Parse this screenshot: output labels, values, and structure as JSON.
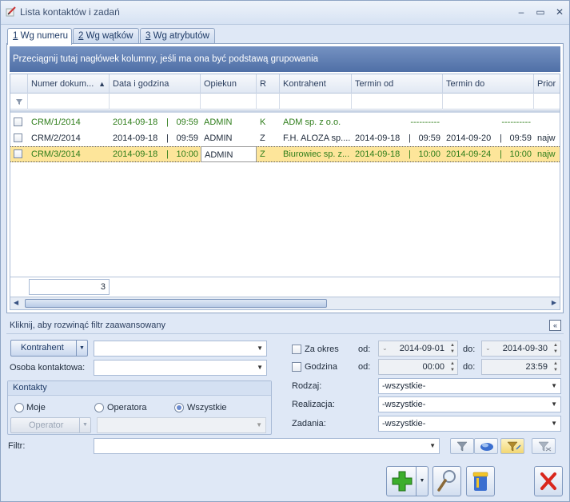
{
  "window": {
    "title": "Lista kontaktów i zadań",
    "minimize": "–",
    "maximize": "▭",
    "close": "✕"
  },
  "tabs": [
    {
      "key": "1",
      "label": " Wg numeru"
    },
    {
      "key": "2",
      "label": " Wg wątków"
    },
    {
      "key": "3",
      "label": " Wg atrybutów"
    }
  ],
  "grid": {
    "group_hint": "Przeciągnij tutaj nagłówek kolumny, jeśli ma ona być podstawą grupowania",
    "columns": [
      "Numer dokum...",
      "Data i godzina",
      "Opiekun",
      "R",
      "Kontrahent",
      "Termin od",
      "Termin do",
      "Prior"
    ],
    "sort_indicator": "▲",
    "rows": [
      {
        "numer": "CRM/1/2014",
        "data": "2014-09-18",
        "godz": "09:59",
        "opiekun": "ADMIN",
        "r": "K",
        "kontrahent": "ADM sp. z o.o.",
        "od_data": "----------",
        "od_godz": "",
        "do_data": "----------",
        "do_godz": "",
        "prior": ""
      },
      {
        "numer": "CRM/2/2014",
        "data": "2014-09-18",
        "godz": "09:59",
        "opiekun": "ADMIN",
        "r": "Z",
        "kontrahent": "F.H. ALOZA sp....",
        "od_data": "2014-09-18",
        "od_godz": "09:59",
        "do_data": "2014-09-20",
        "do_godz": "09:59",
        "prior": "najw"
      },
      {
        "numer": "CRM/3/2014",
        "data": "2014-09-18",
        "godz": "10:00",
        "opiekun": "ADMIN",
        "r": "Z",
        "kontrahent": "Biurowiec sp. z...",
        "od_data": "2014-09-18",
        "od_godz": "10:00",
        "do_data": "2014-09-24",
        "do_godz": "10:00",
        "prior": "najw"
      }
    ],
    "row_sep": "|",
    "count": "3"
  },
  "filter": {
    "advanced_label": "Kliknij, aby rozwinąć filtr zaawansowany",
    "collapse_glyph": "«",
    "kontrahent_button": "Kontrahent",
    "osoba_label": "Osoba kontaktowa:",
    "kontakty_title": "Kontakty",
    "radio_moje": "Moje",
    "radio_operatora": "Operatora",
    "radio_wszystkie": "Wszystkie",
    "operator_button": "Operator",
    "za_okres": "Za okres",
    "godzina": "Godzina",
    "od": "od:",
    "do": "do:",
    "date_from": "2014-09-01",
    "date_to": "2014-09-30",
    "time_from": "00:00",
    "time_to": "23:59",
    "rodzaj_label": "Rodzaj:",
    "realizacja_label": "Realizacja:",
    "zadania_label": "Zadania:",
    "all_value": "-wszystkie-",
    "filtr_label": "Filtr:"
  },
  "colors": {
    "accent": "#4f6fa6",
    "selection": "#fde59a",
    "green_text": "#2e7d1a",
    "close_red": "#d9261c"
  }
}
